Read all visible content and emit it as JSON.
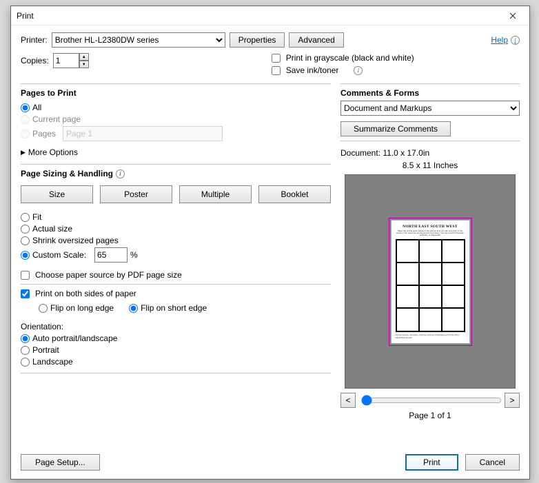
{
  "title": "Print",
  "printer": {
    "label": "Printer:",
    "selected": "Brother HL-L2380DW series"
  },
  "buttons": {
    "properties": "Properties",
    "advanced": "Advanced",
    "help": "Help",
    "summarize": "Summarize Comments",
    "page_setup": "Page Setup...",
    "print": "Print",
    "cancel": "Cancel",
    "size": "Size",
    "poster": "Poster",
    "multiple": "Multiple",
    "booklet": "Booklet"
  },
  "copies": {
    "label": "Copies:",
    "value": "1"
  },
  "options": {
    "grayscale": "Print in grayscale (black and white)",
    "save_ink": "Save ink/toner"
  },
  "pages_to_print": {
    "heading": "Pages to Print",
    "all": "All",
    "current": "Current page",
    "pages": "Pages",
    "pages_placeholder": "Page 1",
    "more_options": "More Options"
  },
  "sizing": {
    "heading": "Page Sizing & Handling",
    "fit": "Fit",
    "actual": "Actual size",
    "shrink": "Shrink oversized pages",
    "custom": "Custom Scale:",
    "custom_value": "65",
    "percent": "%",
    "choose_paper": "Choose paper source by PDF page size"
  },
  "duplex": {
    "both_sides": "Print on both sides of paper",
    "long_edge": "Flip on long edge",
    "short_edge": "Flip on short edge"
  },
  "orientation": {
    "heading": "Orientation:",
    "auto": "Auto portrait/landscape",
    "portrait": "Portrait",
    "landscape": "Landscape"
  },
  "comments": {
    "heading": "Comments & Forms",
    "selected": "Document and Markups"
  },
  "preview": {
    "doc_size": "Document: 11.0 x 17.0in",
    "paper_size": "8.5 x 11 Inches",
    "doc_title": "NORTH EAST SOUTH WEST",
    "page_of": "Page 1 of 1",
    "prev": "<",
    "next": ">"
  }
}
